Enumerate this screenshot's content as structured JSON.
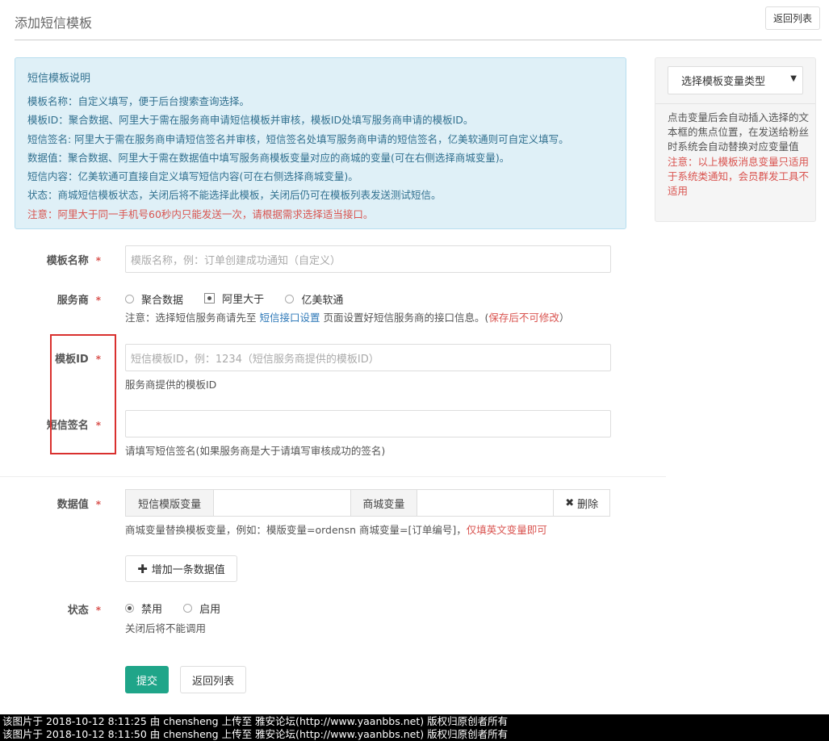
{
  "header": {
    "title": "添加短信模板",
    "back_label": "返回列表"
  },
  "notice": {
    "heading": "短信模板说明",
    "lines": [
      "模板名称：自定义填写，便于后台搜索查询选择。",
      "模板ID：聚合数据、阿里大于需在服务商申请短信模板并审核，模板ID处填写服务商申请的模板ID。",
      "短信签名: 阿里大于需在服务商申请短信签名并审核，短信签名处填写服务商申请的短信签名，亿美软通则可自定义填写。",
      "数据值：聚合数据、阿里大于需在数据值中填写服务商模板变量对应的商城的变量(可在右侧选择商城变量)。",
      "短信内容：亿美软通可直接自定义填写短信内容(可在右侧选择商城变量)。",
      "状态：商城短信模板状态，关闭后将不能选择此模板，关闭后仍可在模板列表发送测试短信。",
      "注意：阿里大于同一手机号60秒内只能发送一次，请根据需求选择适当接口。"
    ]
  },
  "sidebar": {
    "select_value": "选择模板变量类型",
    "help": "点击变量后会自动插入选择的文本框的焦点位置，在发送给粉丝时系统会自动替换对应变量值",
    "warn": "注意：以上模板消息变量只适用于系统类通知，会员群发工具不适用"
  },
  "form": {
    "required_mark": "*",
    "name": {
      "label": "模板名称",
      "placeholder": "模版名称，例：订单创建成功通知（自定义）"
    },
    "provider": {
      "label": "服务商",
      "options": [
        "聚合数据",
        "阿里大于",
        "亿美软通"
      ],
      "selected": "阿里大于",
      "hint_prefix": "注意：选择短信服务商请先至 ",
      "hint_link": "短信接口设置",
      "hint_middle": " 页面设置好短信服务商的接口信息。(",
      "hint_red": "保存后不可修改",
      "hint_suffix": "）"
    },
    "template_id": {
      "label": "模板ID",
      "placeholder": "短信模板ID，例：1234（短信服务商提供的模板ID）",
      "hint": "服务商提供的模板ID"
    },
    "signature": {
      "label": "短信签名",
      "value": "",
      "hint": "请填写短信签名(如果服务商是大于请填写审核成功的签名)"
    },
    "data_value": {
      "label": "数据值",
      "addon_left": "短信模版变量",
      "addon_right": "商城变量",
      "delete_label": "删除",
      "hint_main": "商城变量替换模板变量，例如：模版变量=ordensn 商城变量=[订单编号]，",
      "hint_red": "仅填英文变量即可",
      "add_label": "增加一条数据值"
    },
    "status": {
      "label": "状态",
      "options": [
        "禁用",
        "启用"
      ],
      "selected": "禁用",
      "hint": "关闭后将不能调用"
    },
    "submit_label": "提交",
    "back_label": "返回列表"
  },
  "watermark": {
    "lines": [
      "该图片于 2018-10-12 8:11:25 由 chensheng 上传至 雅安论坛(http://www.yaanbbs.net) 版权归原创者所有",
      "该图片于 2018-10-12 8:11:50 由 chensheng 上传至 雅安论坛(http://www.yaanbbs.net) 版权归原创者所有"
    ]
  }
}
